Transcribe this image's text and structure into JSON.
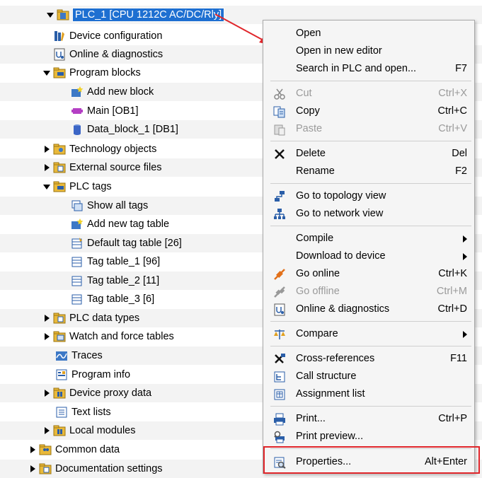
{
  "tree": {
    "items": [
      {
        "label": "PLC_1 [CPU 1212C AC/DC/Rly]",
        "icon": "plc-folder-icon",
        "expander": "expanded",
        "selected": true
      },
      {
        "label": "Device configuration",
        "icon": "device-config-icon",
        "expander": "none"
      },
      {
        "label": "Online & diagnostics",
        "icon": "online-diagnostics-icon",
        "expander": "none"
      },
      {
        "label": "Program blocks",
        "icon": "folder-icon",
        "expander": "expanded"
      },
      {
        "label": "Add new block",
        "icon": "add-block-icon",
        "expander": "none"
      },
      {
        "label": "Main [OB1]",
        "icon": "ob-block-icon",
        "expander": "none"
      },
      {
        "label": "Data_block_1 [DB1]",
        "icon": "data-block-icon",
        "expander": "none"
      },
      {
        "label": "Technology objects",
        "icon": "folder-icon",
        "expander": "collapsed"
      },
      {
        "label": "External source files",
        "icon": "folder-icon",
        "expander": "collapsed"
      },
      {
        "label": "PLC tags",
        "icon": "folder-icon",
        "expander": "expanded"
      },
      {
        "label": "Show all tags",
        "icon": "show-tags-icon",
        "expander": "none"
      },
      {
        "label": "Add new tag table",
        "icon": "add-table-icon",
        "expander": "none"
      },
      {
        "label": "Default tag table [26]",
        "icon": "tag-table-icon",
        "expander": "none"
      },
      {
        "label": "Tag table_1 [96]",
        "icon": "tag-table-icon",
        "expander": "none"
      },
      {
        "label": "Tag table_2 [11]",
        "icon": "tag-table-icon",
        "expander": "none"
      },
      {
        "label": "Tag table_3 [6]",
        "icon": "tag-table-icon",
        "expander": "none"
      },
      {
        "label": "PLC data types",
        "icon": "folder-icon",
        "expander": "collapsed"
      },
      {
        "label": "Watch and force tables",
        "icon": "folder-icon",
        "expander": "collapsed"
      },
      {
        "label": "Traces",
        "icon": "traces-icon",
        "expander": "none"
      },
      {
        "label": "Program info",
        "icon": "program-info-icon",
        "expander": "none"
      },
      {
        "label": "Device proxy data",
        "icon": "folder-icon",
        "expander": "collapsed"
      },
      {
        "label": "Text lists",
        "icon": "text-list-icon",
        "expander": "none"
      },
      {
        "label": "Local modules",
        "icon": "folder-icon",
        "expander": "collapsed"
      },
      {
        "label": "Common data",
        "icon": "folder-icon",
        "expander": "collapsed"
      },
      {
        "label": "Documentation settings",
        "icon": "folder-icon",
        "expander": "collapsed"
      }
    ]
  },
  "context_menu": {
    "items": [
      {
        "label": "Open",
        "shortcut": "",
        "icon": "",
        "disabled": false,
        "submenu": false
      },
      {
        "label": "Open in new editor",
        "shortcut": "",
        "icon": "",
        "disabled": false,
        "submenu": false
      },
      {
        "label": "Search in PLC and open...",
        "shortcut": "F7",
        "icon": "",
        "disabled": false,
        "submenu": false
      },
      {
        "label": "Cut",
        "shortcut": "Ctrl+X",
        "icon": "scissors-icon",
        "disabled": true,
        "submenu": false
      },
      {
        "label": "Copy",
        "shortcut": "Ctrl+C",
        "icon": "copy-icon",
        "disabled": false,
        "submenu": false
      },
      {
        "label": "Paste",
        "shortcut": "Ctrl+V",
        "icon": "paste-icon",
        "disabled": true,
        "submenu": false
      },
      {
        "label": "Delete",
        "shortcut": "Del",
        "icon": "delete-x-icon",
        "disabled": false,
        "submenu": false
      },
      {
        "label": "Rename",
        "shortcut": "F2",
        "icon": "",
        "disabled": false,
        "submenu": false
      },
      {
        "label": "Go to topology view",
        "shortcut": "",
        "icon": "topology-icon",
        "disabled": false,
        "submenu": false
      },
      {
        "label": "Go to network view",
        "shortcut": "",
        "icon": "network-icon",
        "disabled": false,
        "submenu": false
      },
      {
        "label": "Compile",
        "shortcut": "",
        "icon": "",
        "disabled": false,
        "submenu": true
      },
      {
        "label": "Download to device",
        "shortcut": "",
        "icon": "",
        "disabled": false,
        "submenu": true
      },
      {
        "label": "Go online",
        "shortcut": "Ctrl+K",
        "icon": "go-online-icon",
        "disabled": false,
        "submenu": false
      },
      {
        "label": "Go offline",
        "shortcut": "Ctrl+M",
        "icon": "go-offline-icon",
        "disabled": true,
        "submenu": false
      },
      {
        "label": "Online & diagnostics",
        "shortcut": "Ctrl+D",
        "icon": "online-diagnostics-icon",
        "disabled": false,
        "submenu": false
      },
      {
        "label": "Compare",
        "shortcut": "",
        "icon": "compare-icon",
        "disabled": false,
        "submenu": true
      },
      {
        "label": "Cross-references",
        "shortcut": "F11",
        "icon": "cross-references-icon",
        "disabled": false,
        "submenu": false
      },
      {
        "label": "Call structure",
        "shortcut": "",
        "icon": "call-structure-icon",
        "disabled": false,
        "submenu": false
      },
      {
        "label": "Assignment list",
        "shortcut": "",
        "icon": "assignment-list-icon",
        "disabled": false,
        "submenu": false
      },
      {
        "label": "Print...",
        "shortcut": "Ctrl+P",
        "icon": "print-icon",
        "disabled": false,
        "submenu": false
      },
      {
        "label": "Print preview...",
        "shortcut": "",
        "icon": "print-preview-icon",
        "disabled": false,
        "submenu": false
      },
      {
        "label": "Properties...",
        "shortcut": "Alt+Enter",
        "icon": "properties-icon",
        "disabled": false,
        "submenu": false
      }
    ]
  },
  "colors": {
    "selection": "#1e6fd1",
    "annotation_red": "#e0262b",
    "menu_bg": "#f5f5f5",
    "tree_band": "#f3f3f3",
    "disabled_text": "#9a9a9a"
  }
}
